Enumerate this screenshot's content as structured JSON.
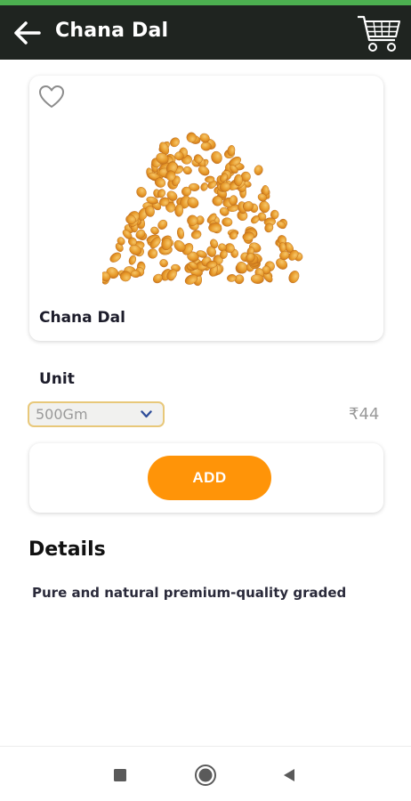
{
  "app_bar": {
    "title": "Chana Dal",
    "background": "#1f2420",
    "status_color": "#4caf50"
  },
  "icons": {
    "back": "arrow-left-icon",
    "cart": "shopping-cart-icon",
    "favorite": "heart-outline-icon",
    "dropdown": "chevron-down-icon",
    "nav_recent": "square-icon",
    "nav_home": "circle-icon",
    "nav_back": "triangle-back-icon"
  },
  "product": {
    "name": "Chana Dal"
  },
  "unit": {
    "label": "Unit",
    "selected": "500Gm",
    "price": "₹44"
  },
  "actions": {
    "add_label": "ADD",
    "add_color": "#ff9408"
  },
  "details": {
    "heading": "Details",
    "text": "Pure and natural premium-quality graded"
  }
}
